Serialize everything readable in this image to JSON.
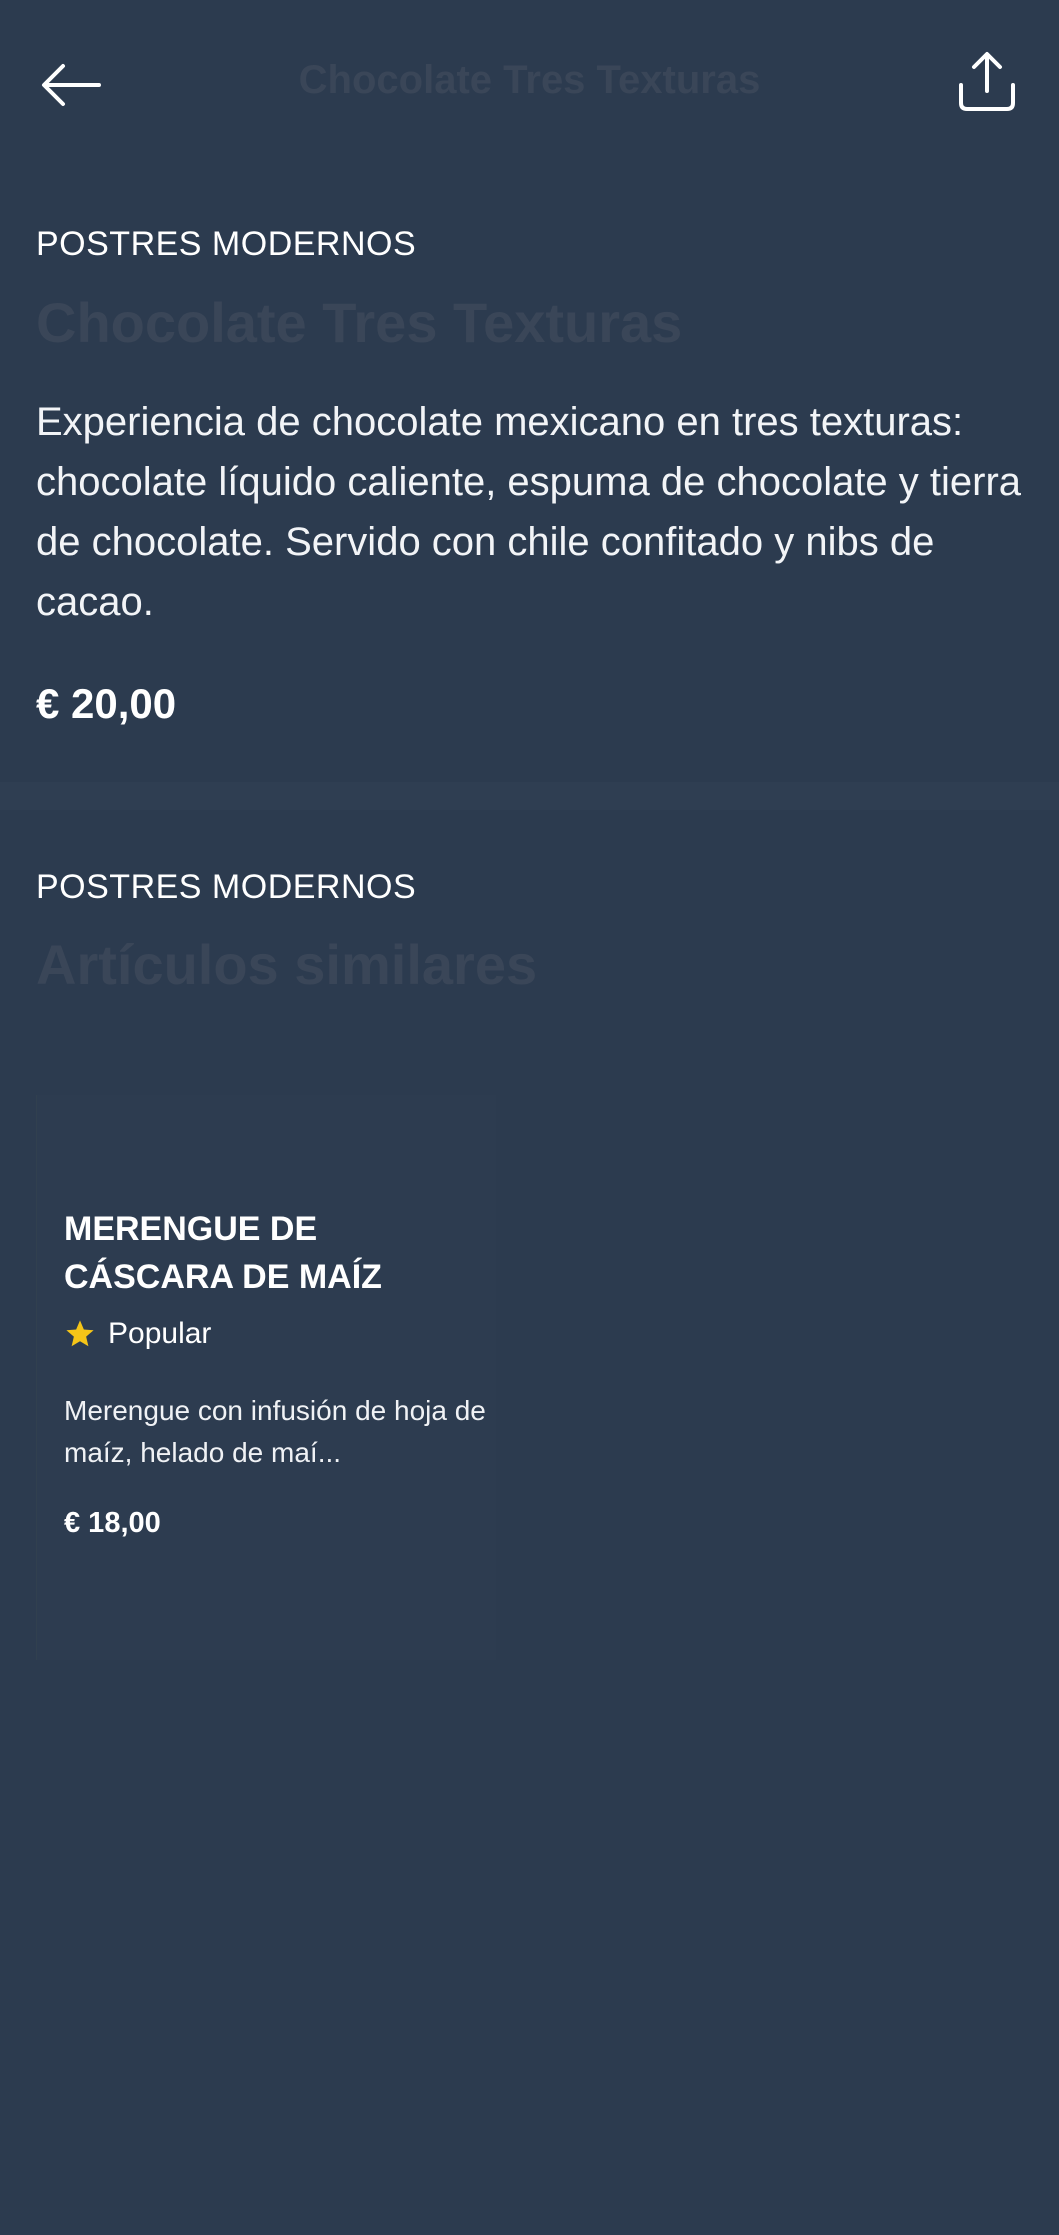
{
  "header": {
    "title": "Chocolate Tres Texturas",
    "back_icon": "arrow-left-icon",
    "share_icon": "share-icon"
  },
  "detail": {
    "category": "POSTRES MODERNOS",
    "title": "Chocolate Tres Texturas",
    "description": "Experiencia de chocolate mexicano en tres texturas: chocolate líquido caliente, espuma de chocolate y tierra de chocolate. Servido con chile confitado y nibs de cacao.",
    "price": "€ 20,00"
  },
  "similar": {
    "category": "POSTRES MODERNOS",
    "title": "Artículos similares",
    "items": [
      {
        "name": "MERENGUE DE CÁSCARA DE MAÍZ",
        "badge": "Popular",
        "badge_icon": "star-icon",
        "description": "Merengue con infusión de hoja de maíz, helado de maí...",
        "price": "€ 18,00"
      }
    ]
  },
  "colors": {
    "background": "#2c3b4f",
    "muted_title": "#3a4658",
    "star": "#f5c518",
    "text": "#ffffff"
  }
}
